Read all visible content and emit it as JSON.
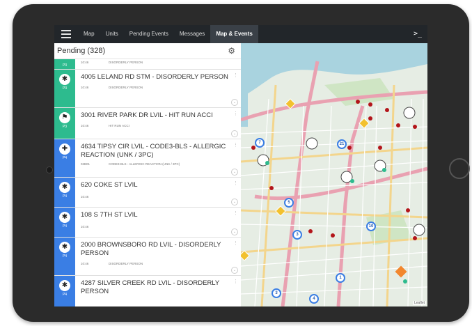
{
  "nav": {
    "items": [
      {
        "label": "Map"
      },
      {
        "label": "Units"
      },
      {
        "label": "Pending Events"
      },
      {
        "label": "Messages"
      },
      {
        "label": "Map & Events",
        "active": true
      }
    ],
    "terminal_label": ">_"
  },
  "pending": {
    "title": "Pending (328)",
    "rows": [
      {
        "address": "",
        "time": "10:46",
        "type": "DISORDERLY PERSON",
        "priority": "P3",
        "color": "green",
        "icon": "person-icon"
      },
      {
        "address": "4005 LELAND RD STM - DISORDERLY PERSON",
        "time": "10:46",
        "type": "DISORDERLY PERSON",
        "priority": "P3",
        "color": "green",
        "icon": "person-icon"
      },
      {
        "address": "3001 RIVER PARK DR LVIL - HIT RUN ACCI",
        "time": "10:46",
        "type": "HIT RUN ACCI",
        "priority": "P3",
        "color": "green",
        "icon": "car-crash-icon"
      },
      {
        "address": "4634 TIPSY CIR LVIL - CODE3-BLS - ALLERGIC REACTION (UNK / 3PC)",
        "time": "02B01",
        "type": "CODE3-BLS - ALLERGIC REACTION (UNK / 3PC)",
        "priority": "P4",
        "color": "blue",
        "icon": "medical-icon"
      },
      {
        "address": "620 COKE ST LVIL",
        "time": "10:46",
        "type": "",
        "priority": "P4",
        "color": "blue",
        "icon": "person-icon"
      },
      {
        "address": "108 S 7TH ST LVIL",
        "time": "10:46",
        "type": "",
        "priority": "P4",
        "color": "blue",
        "icon": "person-icon"
      },
      {
        "address": "2000 BROWNSBORO RD LVIL - DISORDERLY PERSON",
        "time": "10:46",
        "type": "DISORDERLY PERSON",
        "priority": "P4",
        "color": "blue",
        "icon": "person-icon"
      },
      {
        "address": "4287 SILVER CREEK RD LVIL - DISORDERLY PERSON",
        "time": "",
        "type": "",
        "priority": "P4",
        "color": "blue",
        "icon": "person-icon"
      }
    ]
  },
  "map": {
    "cluster_labels": [
      "7",
      "21",
      "5",
      "3",
      "10",
      "1",
      "3",
      "4"
    ],
    "attribution": "Leaflet"
  },
  "colors": {
    "priority_green": "#2dbb8e",
    "priority_blue": "#3a7ee4",
    "topbar": "#22262a",
    "cluster_ring": "#3a7ee4",
    "incident_dot": "#b3151a",
    "warning_diamond": "#f2c12e"
  }
}
